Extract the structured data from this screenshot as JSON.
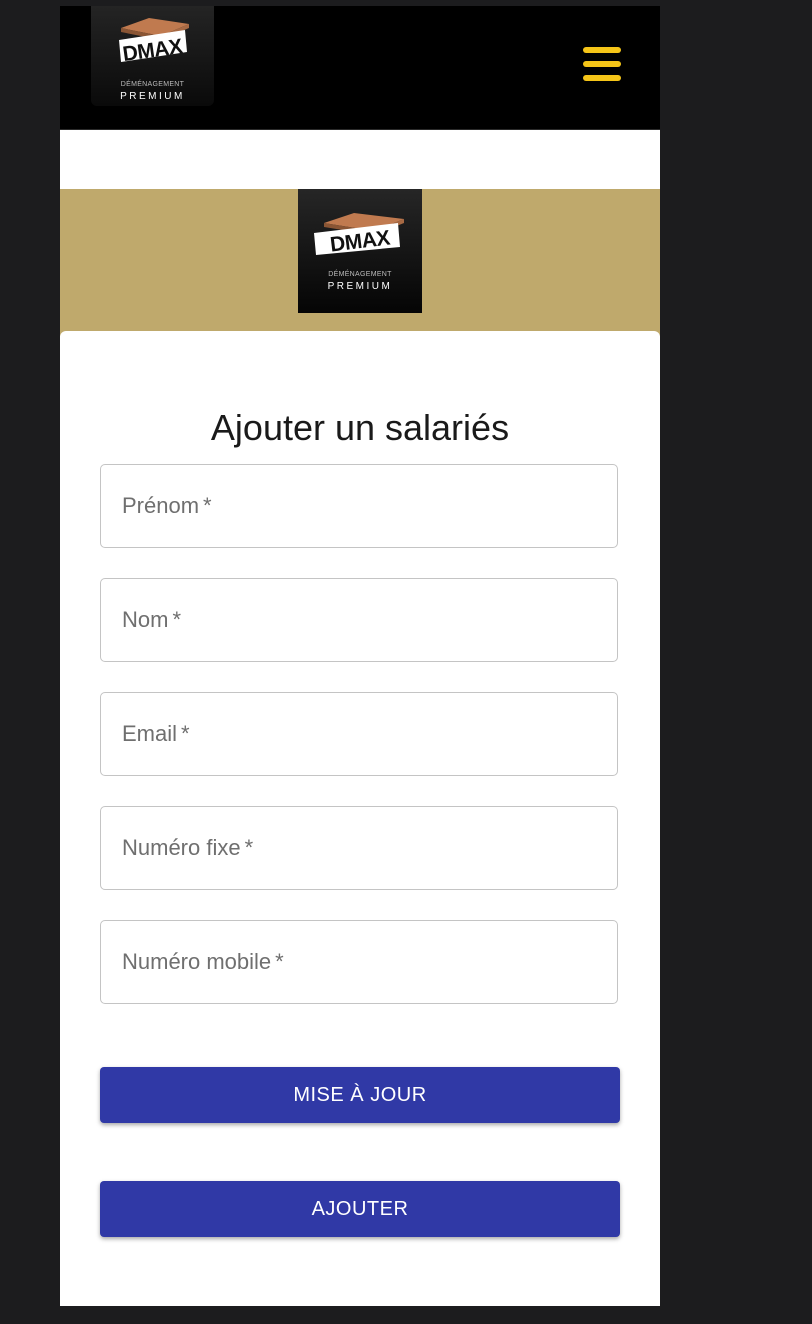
{
  "header": {
    "logo": {
      "brand": "DMAX",
      "tagline_top": "DÉMÉNAGEMENT",
      "tagline_bottom": "PREMIUM"
    },
    "menu_icon": "hamburger-menu-icon"
  },
  "banner": {
    "logo": {
      "brand": "DMAX",
      "tagline_top": "DÉMÉNAGEMENT",
      "tagline_bottom": "PREMIUM"
    }
  },
  "form": {
    "title": "Ajouter un salariés",
    "fields": [
      {
        "label": "Prénom",
        "required": "*",
        "value": ""
      },
      {
        "label": "Nom",
        "required": "*",
        "value": ""
      },
      {
        "label": "Email",
        "required": "*",
        "value": ""
      },
      {
        "label": "Numéro fixe",
        "required": "*",
        "value": ""
      },
      {
        "label": "Numéro mobile",
        "required": "*",
        "value": ""
      }
    ],
    "buttons": {
      "update_label": "MISE À JOUR",
      "add_label": "AJOUTER"
    }
  },
  "colors": {
    "background": "#1c1c1e",
    "header": "#000000",
    "banner": "#bfa96c",
    "menu_icon": "#f5c518",
    "button": "#3039a6",
    "logo_accent": "#c07a4f"
  }
}
